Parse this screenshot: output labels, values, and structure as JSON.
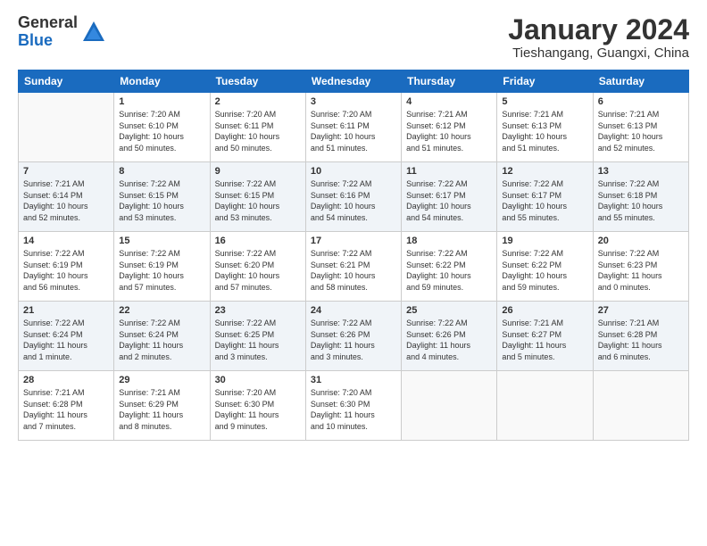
{
  "logo": {
    "general": "General",
    "blue": "Blue"
  },
  "title": "January 2024",
  "location": "Tieshangang, Guangxi, China",
  "days_of_week": [
    "Sunday",
    "Monday",
    "Tuesday",
    "Wednesday",
    "Thursday",
    "Friday",
    "Saturday"
  ],
  "weeks": [
    [
      {
        "num": "",
        "info": ""
      },
      {
        "num": "1",
        "info": "Sunrise: 7:20 AM\nSunset: 6:10 PM\nDaylight: 10 hours\nand 50 minutes."
      },
      {
        "num": "2",
        "info": "Sunrise: 7:20 AM\nSunset: 6:11 PM\nDaylight: 10 hours\nand 50 minutes."
      },
      {
        "num": "3",
        "info": "Sunrise: 7:20 AM\nSunset: 6:11 PM\nDaylight: 10 hours\nand 51 minutes."
      },
      {
        "num": "4",
        "info": "Sunrise: 7:21 AM\nSunset: 6:12 PM\nDaylight: 10 hours\nand 51 minutes."
      },
      {
        "num": "5",
        "info": "Sunrise: 7:21 AM\nSunset: 6:13 PM\nDaylight: 10 hours\nand 51 minutes."
      },
      {
        "num": "6",
        "info": "Sunrise: 7:21 AM\nSunset: 6:13 PM\nDaylight: 10 hours\nand 52 minutes."
      }
    ],
    [
      {
        "num": "7",
        "info": "Sunrise: 7:21 AM\nSunset: 6:14 PM\nDaylight: 10 hours\nand 52 minutes."
      },
      {
        "num": "8",
        "info": "Sunrise: 7:22 AM\nSunset: 6:15 PM\nDaylight: 10 hours\nand 53 minutes."
      },
      {
        "num": "9",
        "info": "Sunrise: 7:22 AM\nSunset: 6:15 PM\nDaylight: 10 hours\nand 53 minutes."
      },
      {
        "num": "10",
        "info": "Sunrise: 7:22 AM\nSunset: 6:16 PM\nDaylight: 10 hours\nand 54 minutes."
      },
      {
        "num": "11",
        "info": "Sunrise: 7:22 AM\nSunset: 6:17 PM\nDaylight: 10 hours\nand 54 minutes."
      },
      {
        "num": "12",
        "info": "Sunrise: 7:22 AM\nSunset: 6:17 PM\nDaylight: 10 hours\nand 55 minutes."
      },
      {
        "num": "13",
        "info": "Sunrise: 7:22 AM\nSunset: 6:18 PM\nDaylight: 10 hours\nand 55 minutes."
      }
    ],
    [
      {
        "num": "14",
        "info": "Sunrise: 7:22 AM\nSunset: 6:19 PM\nDaylight: 10 hours\nand 56 minutes."
      },
      {
        "num": "15",
        "info": "Sunrise: 7:22 AM\nSunset: 6:19 PM\nDaylight: 10 hours\nand 57 minutes."
      },
      {
        "num": "16",
        "info": "Sunrise: 7:22 AM\nSunset: 6:20 PM\nDaylight: 10 hours\nand 57 minutes."
      },
      {
        "num": "17",
        "info": "Sunrise: 7:22 AM\nSunset: 6:21 PM\nDaylight: 10 hours\nand 58 minutes."
      },
      {
        "num": "18",
        "info": "Sunrise: 7:22 AM\nSunset: 6:22 PM\nDaylight: 10 hours\nand 59 minutes."
      },
      {
        "num": "19",
        "info": "Sunrise: 7:22 AM\nSunset: 6:22 PM\nDaylight: 10 hours\nand 59 minutes."
      },
      {
        "num": "20",
        "info": "Sunrise: 7:22 AM\nSunset: 6:23 PM\nDaylight: 11 hours\nand 0 minutes."
      }
    ],
    [
      {
        "num": "21",
        "info": "Sunrise: 7:22 AM\nSunset: 6:24 PM\nDaylight: 11 hours\nand 1 minute."
      },
      {
        "num": "22",
        "info": "Sunrise: 7:22 AM\nSunset: 6:24 PM\nDaylight: 11 hours\nand 2 minutes."
      },
      {
        "num": "23",
        "info": "Sunrise: 7:22 AM\nSunset: 6:25 PM\nDaylight: 11 hours\nand 3 minutes."
      },
      {
        "num": "24",
        "info": "Sunrise: 7:22 AM\nSunset: 6:26 PM\nDaylight: 11 hours\nand 3 minutes."
      },
      {
        "num": "25",
        "info": "Sunrise: 7:22 AM\nSunset: 6:26 PM\nDaylight: 11 hours\nand 4 minutes."
      },
      {
        "num": "26",
        "info": "Sunrise: 7:21 AM\nSunset: 6:27 PM\nDaylight: 11 hours\nand 5 minutes."
      },
      {
        "num": "27",
        "info": "Sunrise: 7:21 AM\nSunset: 6:28 PM\nDaylight: 11 hours\nand 6 minutes."
      }
    ],
    [
      {
        "num": "28",
        "info": "Sunrise: 7:21 AM\nSunset: 6:28 PM\nDaylight: 11 hours\nand 7 minutes."
      },
      {
        "num": "29",
        "info": "Sunrise: 7:21 AM\nSunset: 6:29 PM\nDaylight: 11 hours\nand 8 minutes."
      },
      {
        "num": "30",
        "info": "Sunrise: 7:20 AM\nSunset: 6:30 PM\nDaylight: 11 hours\nand 9 minutes."
      },
      {
        "num": "31",
        "info": "Sunrise: 7:20 AM\nSunset: 6:30 PM\nDaylight: 11 hours\nand 10 minutes."
      },
      {
        "num": "",
        "info": ""
      },
      {
        "num": "",
        "info": ""
      },
      {
        "num": "",
        "info": ""
      }
    ]
  ]
}
